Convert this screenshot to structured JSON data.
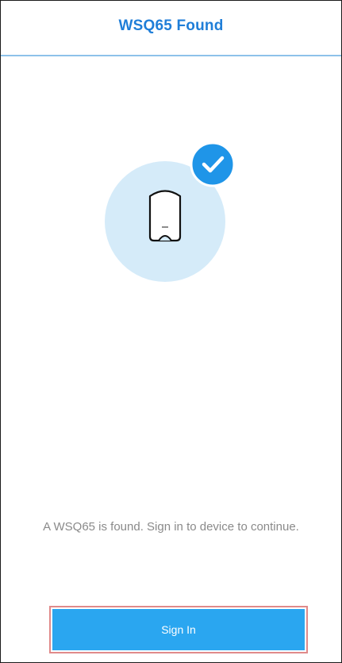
{
  "header": {
    "title": "WSQ65 Found"
  },
  "illustration": {
    "device_icon": "router-icon",
    "status_icon": "checkmark-icon"
  },
  "message": {
    "text": "A WSQ65 is found. Sign in to device to continue."
  },
  "actions": {
    "sign_in_label": "Sign In"
  },
  "colors": {
    "accent": "#1f7ed8",
    "button": "#2aa6f0",
    "header_divider": "#8ec2ea",
    "illustration_circle": "#d5ebf9"
  }
}
